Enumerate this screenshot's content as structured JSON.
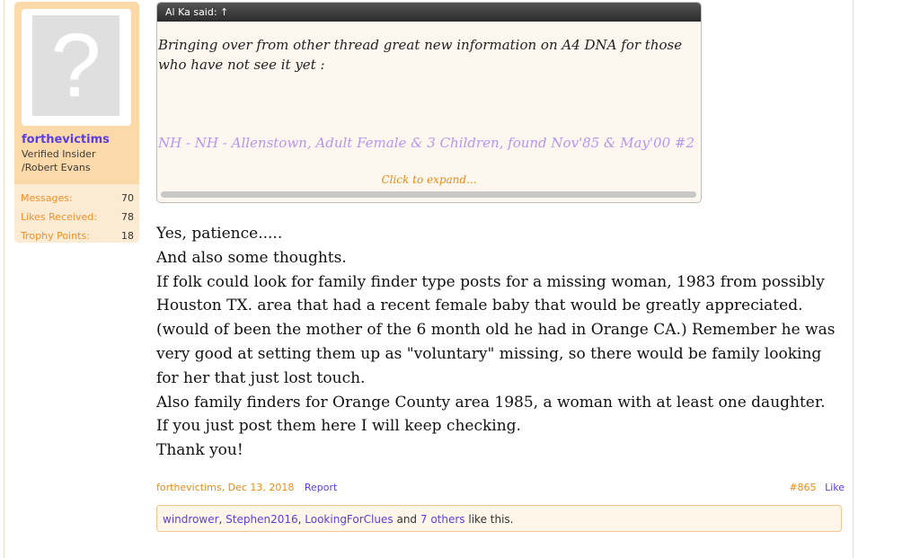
{
  "user": {
    "name": "forthevictims",
    "title_line1": "Verified Insider",
    "title_line2": "/Robert Evans",
    "stats": [
      {
        "label": "Messages:",
        "value": "70"
      },
      {
        "label": "Likes Received:",
        "value": "78"
      },
      {
        "label": "Trophy Points:",
        "value": "18"
      }
    ],
    "avatar_icon": "question-mark-icon"
  },
  "quote": {
    "header": "Al Ka said: ↑",
    "text": "Bringing over from other thread great new information on A4 DNA for those who have not see it yet :",
    "link": "NH - NH - Allenstown, Adult Female & 3 Children, found Nov'85 & May'00 #2",
    "expand": "Click to expand..."
  },
  "message": {
    "lines": [
      "Yes, patience.....",
      "And also some thoughts.",
      "If folk could look for family finder type posts for a missing woman, 1983 from possibly Houston TX. area that had a recent female baby that would be greatly appreciated. (would of been the mother of the 6 month old he had in Orange CA.) Remember he was very good at setting them up as \"voluntary\" missing, so there would be family looking for her that just lost touch.",
      "Also family finders for Orange County area 1985, a woman with at least one daughter.",
      "If you just post them here I will keep checking.",
      "Thank you!"
    ]
  },
  "footer": {
    "author_date": "forthevictims, Dec 13, 2018",
    "report": "Report",
    "permalink": "#865",
    "like": "Like"
  },
  "likes": {
    "users": [
      "windrower",
      "Stephen2016",
      "LookingForClues"
    ],
    "and": "and",
    "others": "7 others",
    "suffix": "like this."
  },
  "colors": {
    "accent_orange": "#ee8a10",
    "link_purple": "#5a3fe0",
    "card_bg": "#fcd9a9"
  }
}
